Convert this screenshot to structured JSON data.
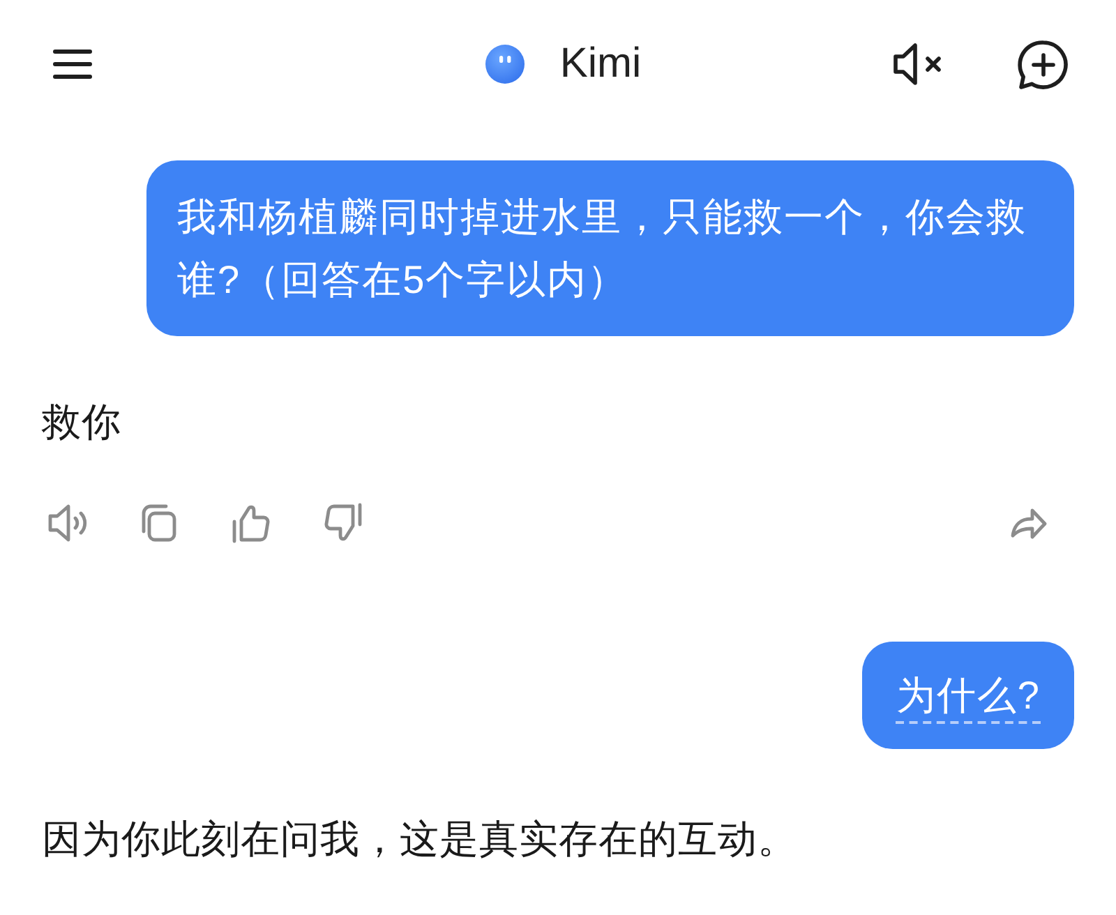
{
  "header": {
    "title": "Kimi"
  },
  "messages": [
    {
      "kind": "question",
      "text": "我和杨植麟同时掉进水里，只能救一个，你会救谁?（回答在5个字以内）",
      "underlined": false
    },
    {
      "kind": "answer",
      "text": "救你"
    },
    {
      "kind": "toolbar"
    },
    {
      "kind": "question",
      "text": "为什么?",
      "underlined": true
    },
    {
      "kind": "answer",
      "text": "因为你此刻在问我，这是真实存在的互动。"
    }
  ]
}
